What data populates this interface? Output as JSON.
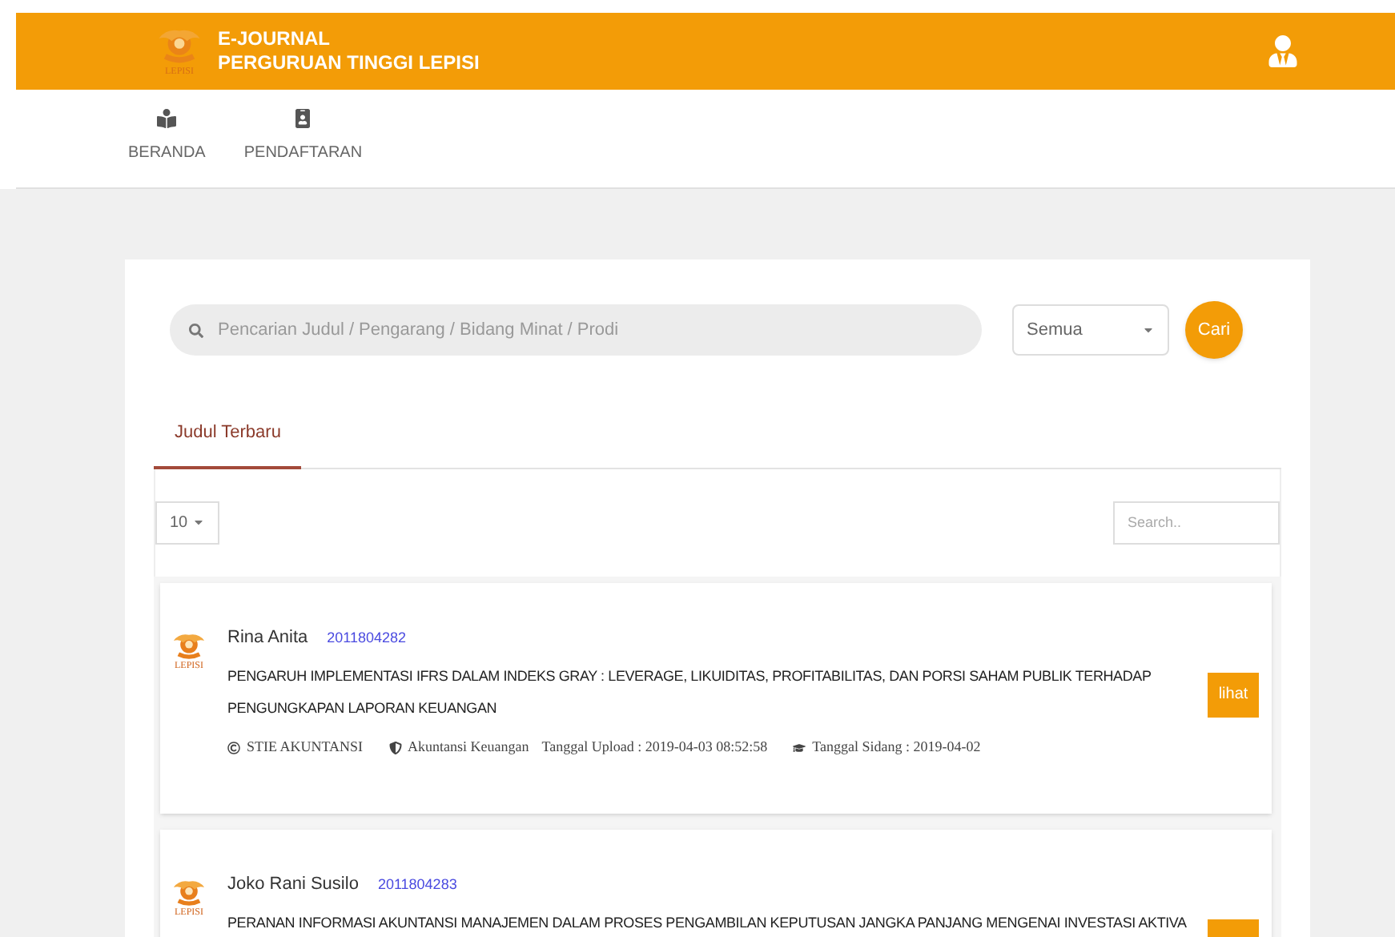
{
  "header": {
    "title_line_1": "E-JOURNAL",
    "title_line_2": "PERGURUAN TINGGI LEPISI",
    "logo_caption": "LEPISI"
  },
  "nav": [
    {
      "label": "BERANDA",
      "kind": "home"
    },
    {
      "label": "PENDAFTARAN",
      "kind": "register"
    }
  ],
  "search": {
    "placeholder": "Pencarian Judul / Pengarang / Bidang Minat / Prodi",
    "category": "Semua",
    "button": "Cari"
  },
  "tabs": [
    {
      "label": "Judul Terbaru",
      "selected": true
    }
  ],
  "list_controls": {
    "page_size": "10",
    "search_placeholder": "Search.."
  },
  "entries": [
    {
      "author": "Rina Anita",
      "id": "2011804282",
      "logo_caption": "LEPISI",
      "title": "PENGARUH IMPLEMENTASI IFRS DALAM INDEKS GRAY : LEVERAGE, LIKUIDITAS, PROFITABILITAS, DAN PORSI SAHAM PUBLIK TERHADAP PENGUNGKAPAN LAPORAN KEUANGAN",
      "school": "STIE AKUNTANSI",
      "major": "Akuntansi Keuangan",
      "uploaded": "Tanggal Upload : 2019-04-03 08:52:58",
      "session": "Tanggal Sidang : 2019-04-02",
      "button": "lihat"
    },
    {
      "author": "Joko Rani Susilo",
      "id": "2011804283",
      "logo_caption": "LEPISI",
      "title": "PERANAN INFORMASI AKUNTANSI MANAJEMEN DALAM PROSES PENGAMBILAN KEPUTUSAN JANGKA PANJANG MENGENAI INVESTASI AKTIVA"
    }
  ]
}
